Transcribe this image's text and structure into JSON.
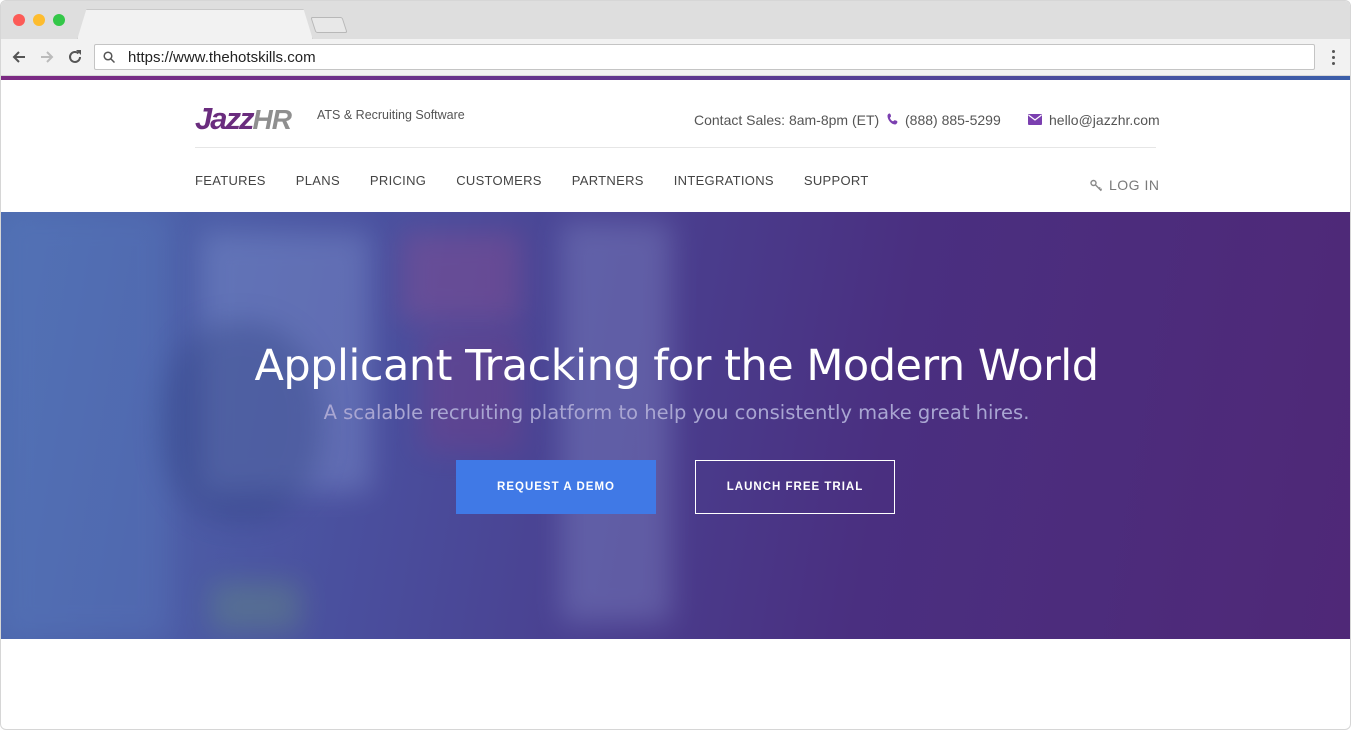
{
  "browser": {
    "url": "https://www.thehotskills.com"
  },
  "site": {
    "logo": {
      "part1": "Jazz",
      "part2": "HR"
    },
    "tagline": "ATS & Recruiting Software",
    "contact_text": "Contact Sales: 8am-8pm (ET)",
    "phone": "(888) 885-5299",
    "email": "hello@jazzhr.com",
    "nav": [
      "FEATURES",
      "PLANS",
      "PRICING",
      "CUSTOMERS",
      "PARTNERS",
      "INTEGRATIONS",
      "SUPPORT"
    ],
    "login_label": "LOG IN"
  },
  "hero": {
    "title": "Applicant Tracking for the Modern World",
    "subtitle": "A scalable recruiting platform to help you consistently make great hires.",
    "primary_button": "REQUEST A DEMO",
    "secondary_button": "LAUNCH FREE TRIAL"
  },
  "colors": {
    "brand_purple": "#6a2c7e",
    "button_blue": "#4079e6",
    "hero_gradient_start": "#4e6cb0",
    "hero_gradient_end": "#4f2877"
  }
}
